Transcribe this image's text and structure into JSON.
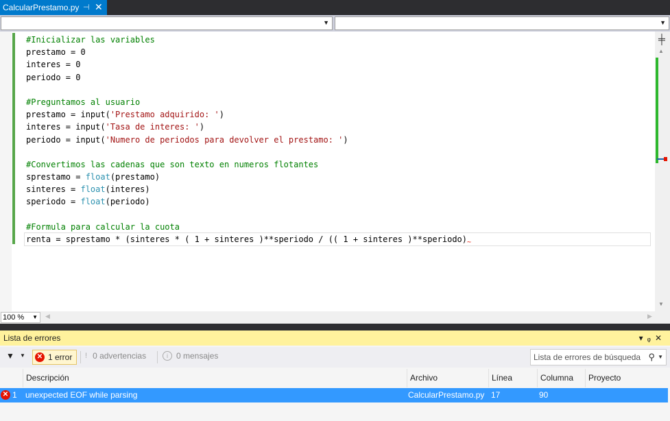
{
  "tab": {
    "title": "CalcularPrestamo.py",
    "pin_icon": "pin-icon",
    "close_icon": "close-icon"
  },
  "editor": {
    "lines": [
      [
        {
          "t": "#Inicializar las variables",
          "c": "cmt"
        }
      ],
      [
        {
          "t": "prestamo = 0"
        }
      ],
      [
        {
          "t": "interes = 0"
        }
      ],
      [
        {
          "t": "periodo = 0"
        }
      ],
      [],
      [
        {
          "t": "#Preguntamos al usuario",
          "c": "cmt"
        }
      ],
      [
        {
          "t": "prestamo = input("
        },
        {
          "t": "'Prestamo adquirido: '",
          "c": "str"
        },
        {
          "t": ")"
        }
      ],
      [
        {
          "t": "interes = input("
        },
        {
          "t": "'Tasa de interes: '",
          "c": "str"
        },
        {
          "t": ")"
        }
      ],
      [
        {
          "t": "periodo = input("
        },
        {
          "t": "'Numero de periodos para devolver el prestamo: '",
          "c": "str"
        },
        {
          "t": ")"
        }
      ],
      [],
      [
        {
          "t": "#Convertimos las cadenas que son texto en numeros flotantes",
          "c": "cmt"
        }
      ],
      [
        {
          "t": "sprestamo = "
        },
        {
          "t": "float",
          "c": "bi"
        },
        {
          "t": "(prestamo)"
        }
      ],
      [
        {
          "t": "sinteres = "
        },
        {
          "t": "float",
          "c": "bi"
        },
        {
          "t": "(interes)"
        }
      ],
      [
        {
          "t": "speriodo = "
        },
        {
          "t": "float",
          "c": "bi"
        },
        {
          "t": "(periodo)"
        }
      ],
      [],
      [
        {
          "t": "#Formula para calcular la cuota",
          "c": "cmt"
        }
      ],
      [
        {
          "t": "renta = sprestamo * (sinteres * ( 1 + sinteres )**speriodo / (( 1 + sinteres )**speriodo)"
        }
      ]
    ],
    "current_line": 16,
    "colors": {
      "comment": "#008000",
      "string": "#a31515",
      "builtin": "#2b91af",
      "change_bar": "#57a64a"
    }
  },
  "zoom": {
    "value": "100 %"
  },
  "error_list": {
    "title": "Lista de errores",
    "errors_label": "1 error",
    "warnings_label": "0 advertencias",
    "messages_label": "0 mensajes",
    "search_placeholder": "Lista de errores de búsqueda",
    "columns": [
      "Descripción",
      "Archivo",
      "Línea",
      "Columna",
      "Proyecto"
    ],
    "rows": [
      {
        "num": "1",
        "description": "unexpected EOF while parsing",
        "file": "CalcularPrestamo.py",
        "line": "17",
        "column": "90",
        "project": ""
      }
    ],
    "colors": {
      "header": "#fff29d",
      "selected_row": "#3399ff",
      "error": "#e51400"
    }
  }
}
